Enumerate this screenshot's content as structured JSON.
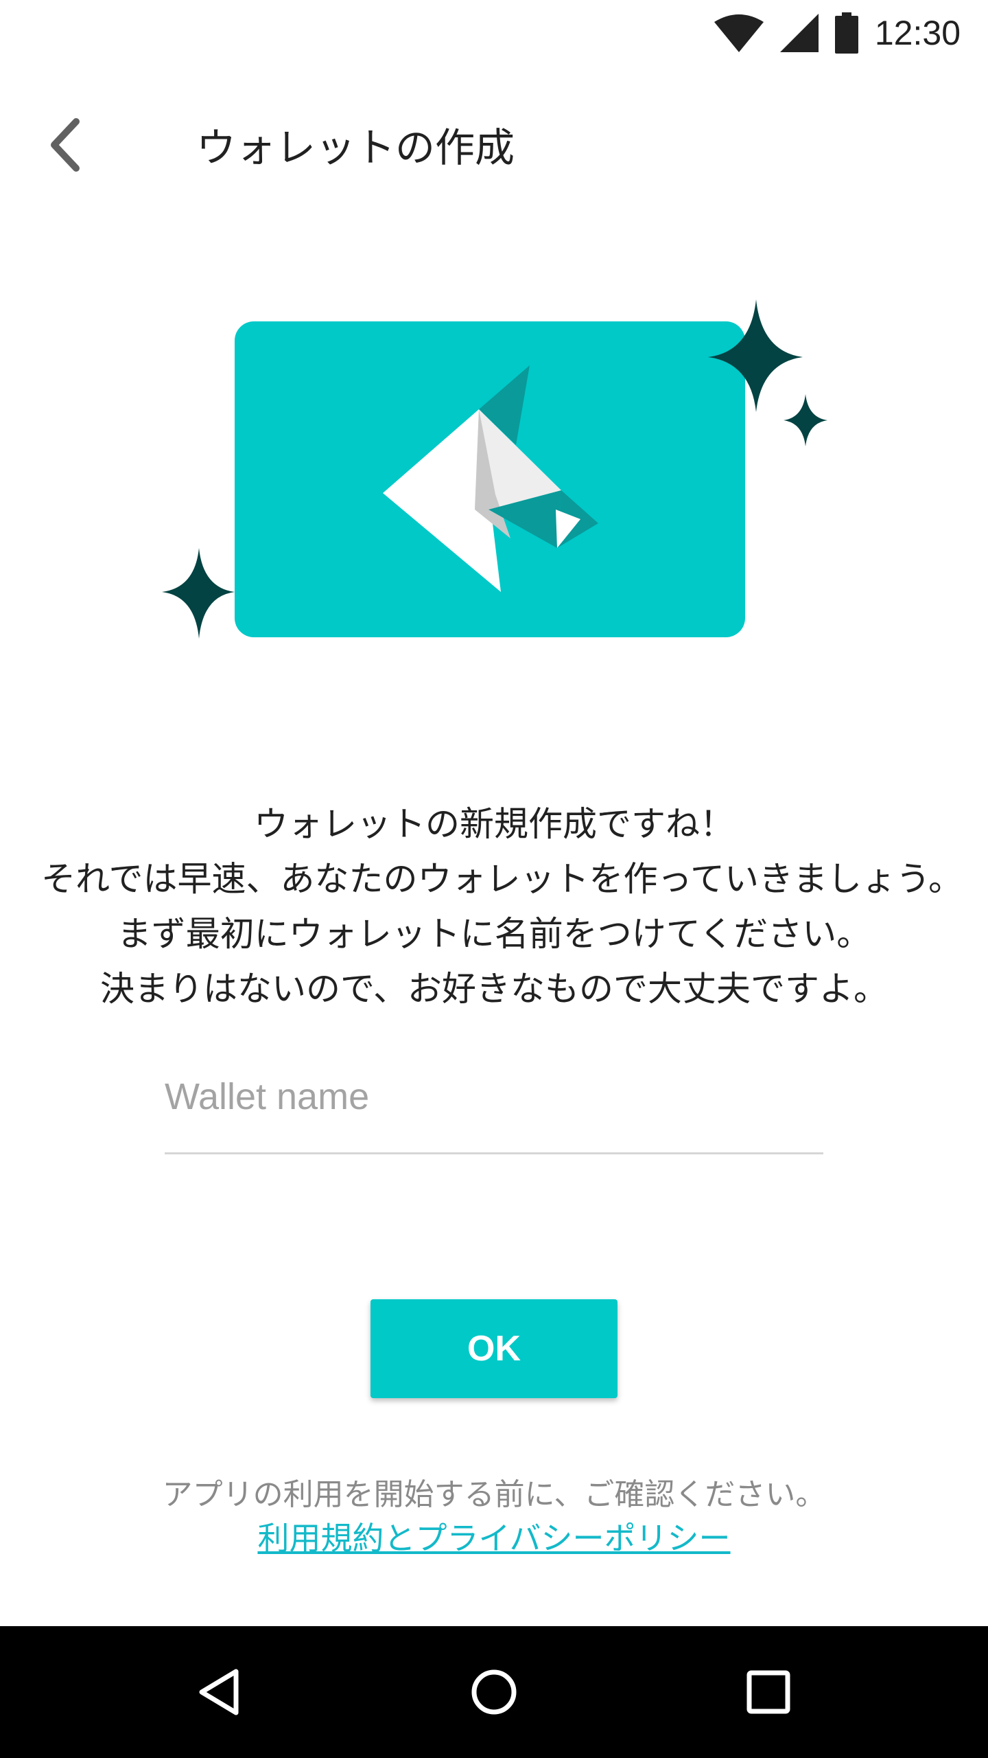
{
  "status_bar": {
    "time": "12:30",
    "icons": [
      "wifi-icon",
      "cellular-signal-icon",
      "battery-icon"
    ]
  },
  "toolbar": {
    "back_icon": "chevron-left-icon",
    "title": "ウォレットの作成"
  },
  "hero": {
    "icons": [
      "wallet-card",
      "origami-bird-logo",
      "sparkle-icon"
    ],
    "colors": {
      "card": "#00c9c8",
      "sparkle": "#044343",
      "logo_dark": "#0a9a9a"
    }
  },
  "message": {
    "lines": [
      "ウォレットの新規作成ですね！",
      "それでは早速、あなたのウォレットを作っていきましょう。",
      "まず最初にウォレットに名前をつけてください。",
      "決まりはないので、お好きなもので大丈夫ですよ。"
    ]
  },
  "wallet_name": {
    "placeholder": "Wallet name",
    "value": ""
  },
  "ok_button": {
    "label": "OK",
    "color": "#00c9c8"
  },
  "footer": {
    "notice": "アプリの利用を開始する前に、ご確認ください。",
    "terms_link": "利用規約とプライバシーポリシー",
    "link_color": "#13b9c9"
  },
  "nav_bar": {
    "icons": [
      "back-triangle-icon",
      "home-circle-icon",
      "recents-square-icon"
    ]
  }
}
